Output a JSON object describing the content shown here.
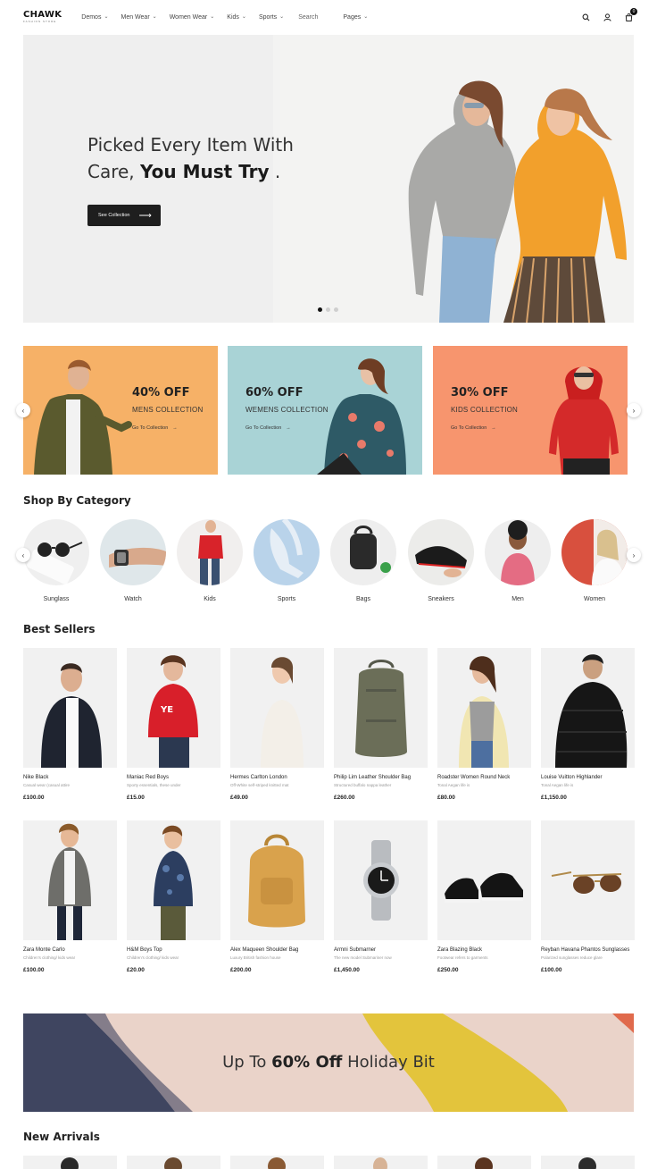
{
  "header": {
    "logo": "CHAWK",
    "logo_sub": "FASHION STORE",
    "nav": [
      "Demos",
      "Men Wear",
      "Women Wear",
      "Kids",
      "Sports"
    ],
    "search": "Search",
    "pages": "Pages",
    "cart_count": "0",
    "accent": "#111111"
  },
  "hero": {
    "title_line1": "Picked Every Item With",
    "title_plain": "Care, ",
    "title_bold": "You Must Try",
    "title_end": " .",
    "button": "See Collection"
  },
  "promos": [
    {
      "title": "40% OFF",
      "sub": "MENS COLLECTION",
      "link": "Go To Collection",
      "color": "#f6b167"
    },
    {
      "title": "60% OFF",
      "sub": "WEMENS COLLECTION",
      "link": "Go To Collection",
      "color": "#a9d3d6"
    },
    {
      "title": "30% OFF",
      "sub": "KIDS COLLECTION",
      "link": "Go To Collection",
      "color": "#f7956e"
    }
  ],
  "categories": {
    "title": "Shop By Category",
    "items": [
      "Sunglass",
      "Watch",
      "Kids",
      "Sports",
      "Bags",
      "Sneakers",
      "Men",
      "Women"
    ]
  },
  "best_sellers": {
    "title": "Best Sellers",
    "products": [
      {
        "name": "Nike Black",
        "desc": "Casual wear (casual attire",
        "price": "£100.00"
      },
      {
        "name": "Maniac Red Boys",
        "desc": "Sporty essentials, these under",
        "price": "£15.00"
      },
      {
        "name": "Hermes Carlton London",
        "desc": "Off-White self-striped knitted mat",
        "price": "£49.00"
      },
      {
        "name": "Philip Lim Leather Shoulder Bag",
        "desc": "Structured buffalo nappa leather",
        "price": "£260.00"
      },
      {
        "name": "Roadster Women Round Neck",
        "desc": "Tonal Aegan life is",
        "price": "£80.00"
      },
      {
        "name": "Louise Vuitton Highlander",
        "desc": "Tonal Aegan life is",
        "price": "£1,150.00"
      },
      {
        "name": "Zara Monte Carlo",
        "desc": "Children's clothing/ kids wear",
        "price": "£100.00"
      },
      {
        "name": "H&M Boys Top",
        "desc": "Children's clothing/ kids wear",
        "price": "£20.00"
      },
      {
        "name": "Alex Maqueen Shoulder Bag",
        "desc": "Luxury British fashion house",
        "price": "£200.00"
      },
      {
        "name": "Armni Submarner",
        "desc": "The new model Submariner now",
        "price": "£1,450.00"
      },
      {
        "name": "Zara Blazing Black",
        "desc": "Footwear refers to garments",
        "price": "£250.00"
      },
      {
        "name": "Reyban Havana Phantos Sunglasses",
        "desc": "Polarized sunglasses reduce glare",
        "price": "£100.00"
      }
    ]
  },
  "sale_banner": {
    "prefix": "Up To ",
    "bold": "60% Off",
    "suffix": " Holiday Bit"
  },
  "new_arrivals": {
    "title": "New Arrivals"
  }
}
